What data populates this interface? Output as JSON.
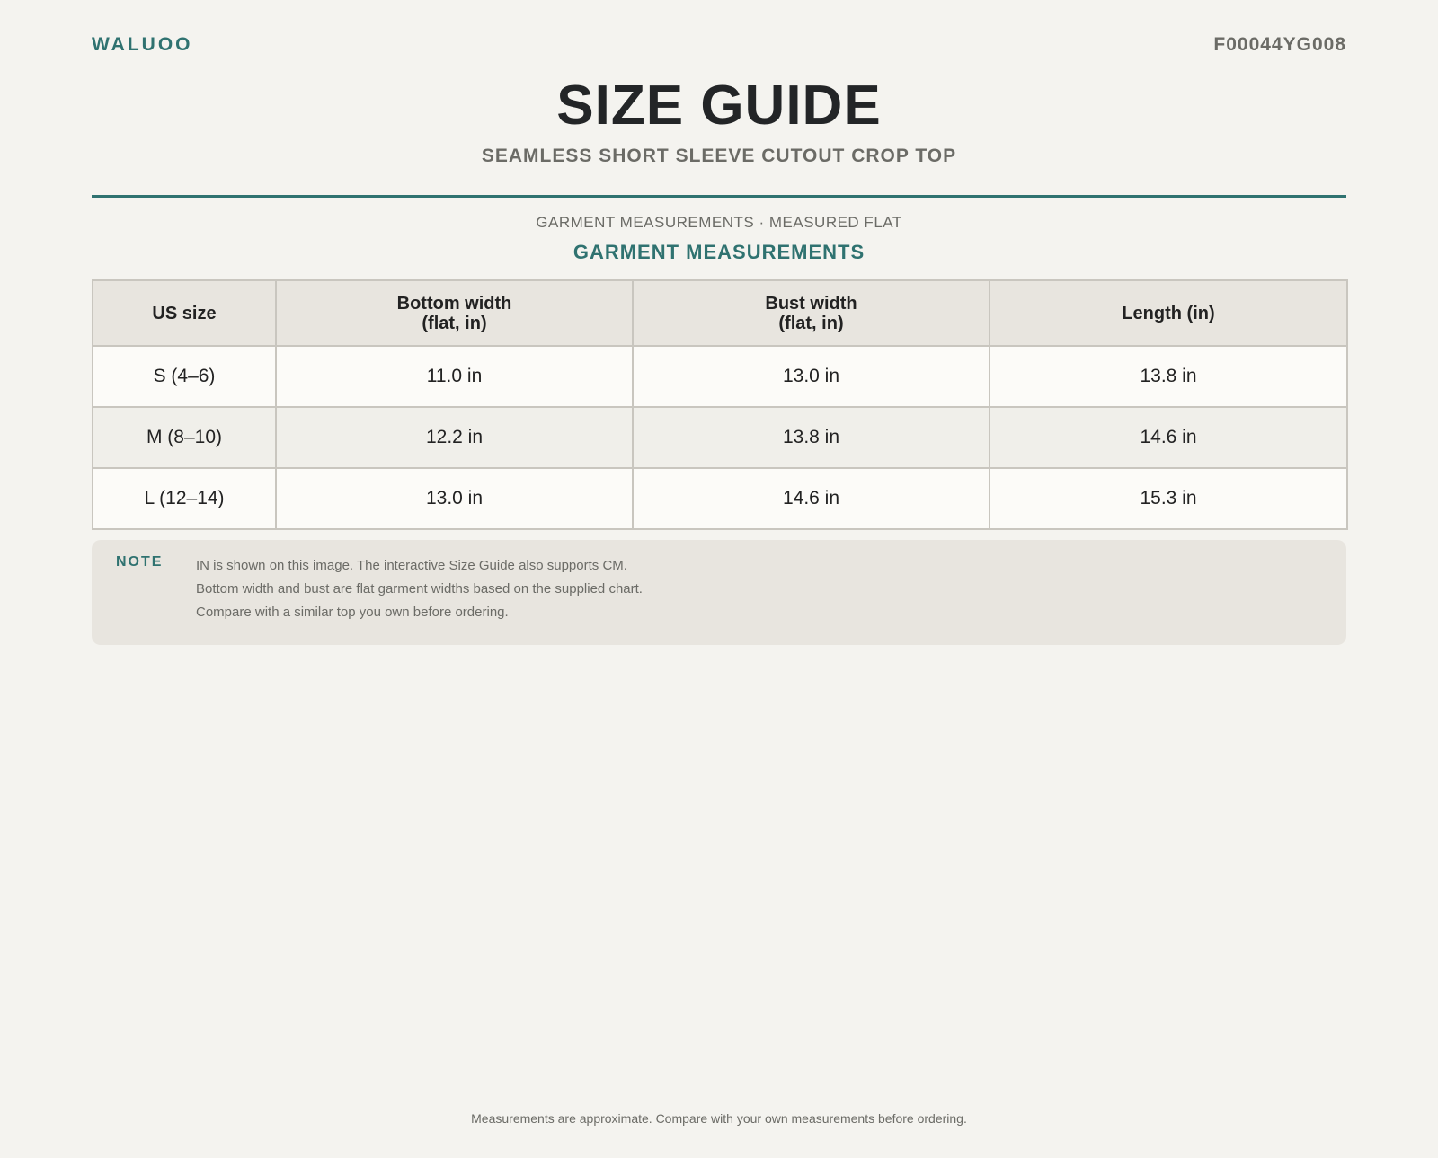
{
  "header": {
    "brand": "WALUOO",
    "sku": "F00044YG008"
  },
  "title": "SIZE GUIDE",
  "subtitle": "SEAMLESS SHORT SLEEVE CUTOUT CROP TOP",
  "section": {
    "caption": "GARMENT MEASUREMENTS · MEASURED FLAT",
    "title": "GARMENT MEASUREMENTS"
  },
  "table": {
    "headers": [
      {
        "line1": "US size",
        "line2": ""
      },
      {
        "line1": "Bottom width",
        "line2": "(flat, in)"
      },
      {
        "line1": "Bust width",
        "line2": "(flat, in)"
      },
      {
        "line1": "Length (in)",
        "line2": ""
      }
    ],
    "rows": [
      [
        "S (4–6)",
        "11.0 in",
        "13.0 in",
        "13.8 in"
      ],
      [
        "M (8–10)",
        "12.2 in",
        "13.8 in",
        "14.6 in"
      ],
      [
        "L (12–14)",
        "13.0 in",
        "14.6 in",
        "15.3 in"
      ]
    ]
  },
  "note": {
    "label": "NOTE",
    "lines": [
      "IN is shown on this image. The interactive Size Guide also supports CM.",
      "Bottom width and bust are flat garment widths based on the supplied chart.",
      "Compare with a similar top you own before ordering."
    ]
  },
  "footer": "Measurements are approximate. Compare with your own measurements before ordering.",
  "colors": {
    "accent": "#2f7270",
    "background": "#f4f3ef",
    "muted_text": "#6b6b66",
    "header_bg": "#e8e5df"
  }
}
